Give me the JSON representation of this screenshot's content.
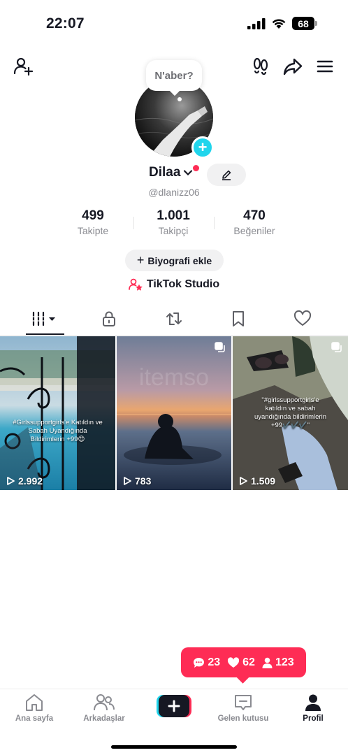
{
  "status": {
    "time": "22:07",
    "battery": "68"
  },
  "header": {
    "note": "N'aber?"
  },
  "profile": {
    "name": "Dilaa",
    "handle": "@dlanizz06",
    "stats": [
      {
        "value": "499",
        "label": "Takipte"
      },
      {
        "value": "1.001",
        "label": "Takipçi"
      },
      {
        "value": "470",
        "label": "Beğeniler"
      }
    ],
    "bio_button": "Biyografi ekle",
    "studio": "TikTok Studio"
  },
  "videos": [
    {
      "caption": "#Girlssupportgirls'e Katıldın ve Sabah Uyandığında Bildirimlerin +99😍",
      "views": "2.992"
    },
    {
      "caption": "",
      "views": "783"
    },
    {
      "caption": "\"#girlssupportgirls'e katıldın ve sabah uyandığında bildirimlerin +99✔️✔️✔️\"",
      "views": "1.509"
    }
  ],
  "notification": {
    "comments": "23",
    "likes": "62",
    "followers": "123"
  },
  "nav": [
    {
      "label": "Ana sayfa"
    },
    {
      "label": "Arkadaşlar"
    },
    {
      "label": ""
    },
    {
      "label": "Gelen kutusu"
    },
    {
      "label": "Profil"
    }
  ],
  "colors": {
    "accent": "#fe2c55",
    "cyan": "#20d5ec",
    "text": "#161823",
    "muted": "#8a8b91"
  },
  "icons": [
    "add-friend-icon",
    "footprints-icon",
    "share-icon",
    "menu-icon",
    "edit-icon",
    "grid-icon",
    "lock-icon",
    "repost-icon",
    "bookmark-icon",
    "heart-icon",
    "home-icon",
    "friends-icon",
    "inbox-icon",
    "profile-icon"
  ]
}
